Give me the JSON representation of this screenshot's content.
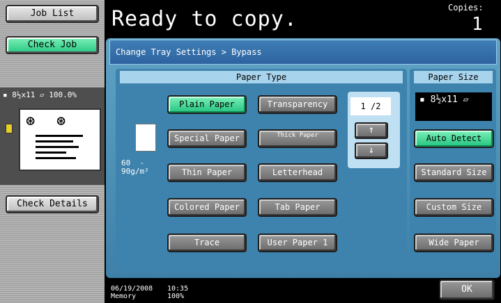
{
  "left_panel": {
    "job_list_label": "Job List",
    "check_job_label": "Check Job",
    "preview_info": "▪ 8½x11 ▱  100.0%",
    "check_details_label": "Check Details"
  },
  "header": {
    "status": "Ready to copy.",
    "copies_label": "Copies:",
    "copies_value": "1"
  },
  "dialog": {
    "breadcrumb": "Change Tray Settings > Bypass",
    "paper_type": {
      "title": "Paper Type",
      "weight": "60  -\n90g/m²",
      "buttons": {
        "plain": "Plain Paper",
        "transparency": "Transparency",
        "special": "Special Paper",
        "thick": "Thick Paper",
        "thin": "Thin Paper",
        "letterhead": "Letterhead",
        "colored": "Colored Paper",
        "tab": "Tab Paper",
        "trace": "Trace",
        "user1": "User Paper 1"
      },
      "selected": "plain",
      "page_indicator": "1 /2",
      "up_arrow": "↑",
      "down_arrow": "↓"
    },
    "paper_size": {
      "title": "Paper Size",
      "current": "▪ 8½x11 ▱",
      "buttons": {
        "auto": "Auto Detect",
        "standard": "Standard Size",
        "custom": "Custom Size",
        "wide": "Wide Paper"
      },
      "selected": "auto"
    }
  },
  "footer": {
    "date": "06/19/2008",
    "memory_label": "Memory",
    "time": "10:35",
    "memory_value": "100%",
    "ok_label": "OK"
  },
  "colors": {
    "selected_green": "#27c983",
    "dialog_blue": "#3e80a8",
    "header_blue": "#a8d3ed"
  }
}
